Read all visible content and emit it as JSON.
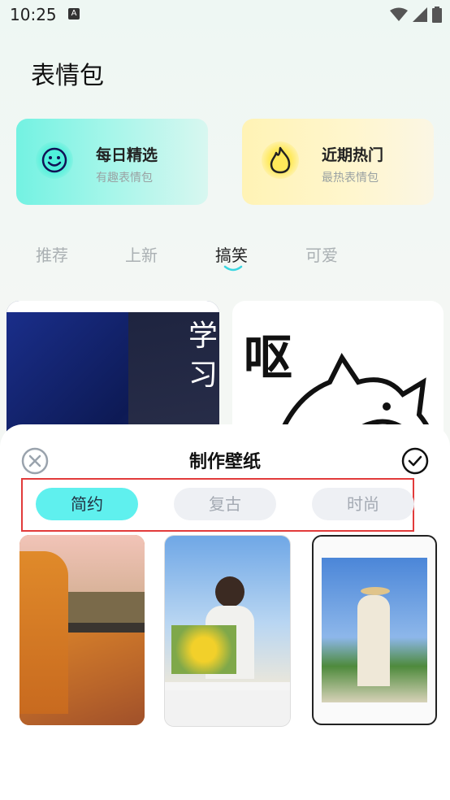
{
  "status_bar": {
    "time": "10:25",
    "indicator": "A"
  },
  "header": {
    "title": "表情包"
  },
  "cards": [
    {
      "title": "每日精选",
      "subtitle": "有趣表情包",
      "icon": "smile-icon"
    },
    {
      "title": "近期热门",
      "subtitle": "最热表情包",
      "icon": "flame-icon"
    }
  ],
  "category_tabs": {
    "items": [
      "推荐",
      "上新",
      "搞笑",
      "可爱"
    ],
    "active": "搞笑"
  },
  "tiles": {
    "left_text_1": "学",
    "left_text_2": "习",
    "right_text": "呕"
  },
  "sheet": {
    "title": "制作壁纸",
    "styles": [
      "简约",
      "复古",
      "时尚"
    ],
    "active_style": "简约"
  },
  "colors": {
    "accent": "#5ff0ee",
    "highlight_border": "#e23b3b"
  }
}
